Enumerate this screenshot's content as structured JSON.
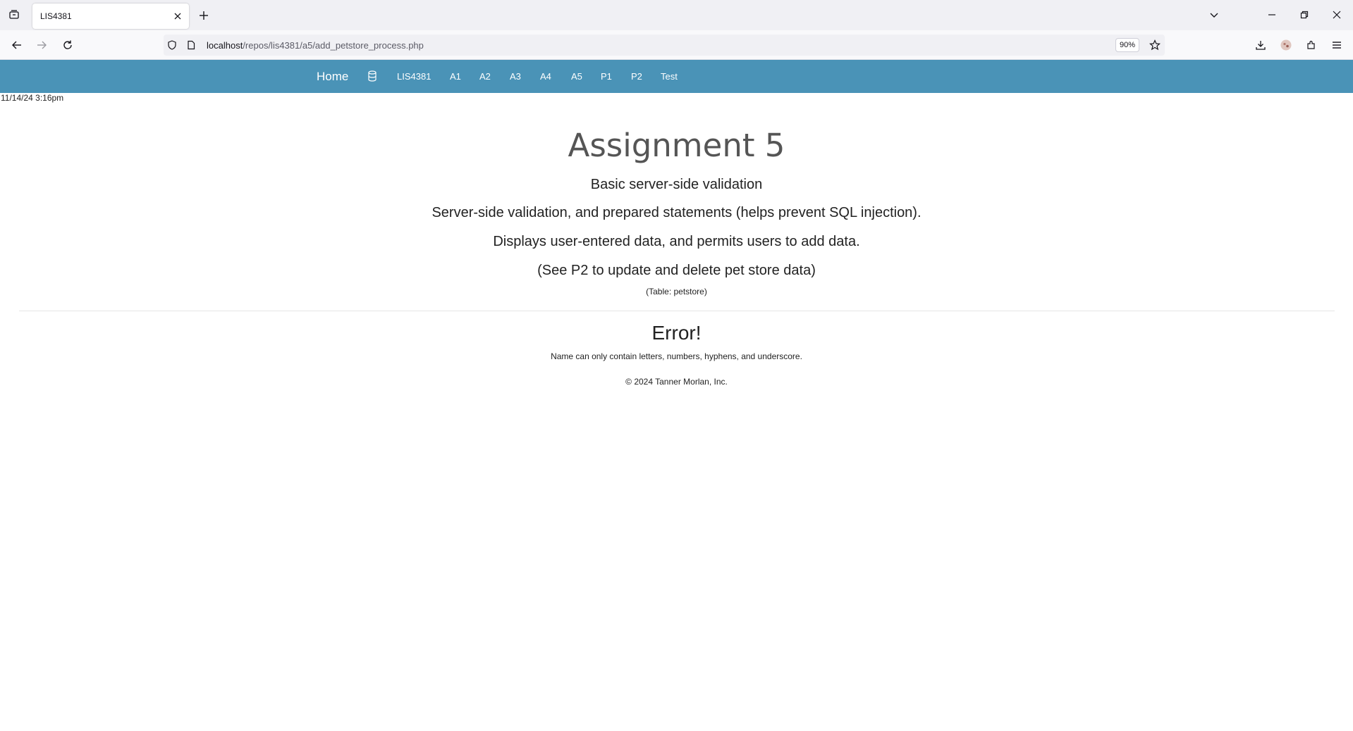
{
  "browser": {
    "tab_title": "LIS4381",
    "url_host": "localhost",
    "url_path": "/repos/lis4381/a5/add_petstore_process.php",
    "zoom": "90%",
    "icons": [
      "tab-list-icon",
      "close-icon",
      "plus-icon",
      "chevron-down-icon",
      "minimize-icon",
      "restore-icon",
      "close-window-icon",
      "back-arrow-icon",
      "forward-arrow-icon",
      "reload-icon",
      "shield-icon",
      "page-icon",
      "star-icon",
      "download-icon",
      "profile-icon",
      "extensions-icon",
      "menu-icon"
    ]
  },
  "site_nav": {
    "brand": "Home",
    "db_icon": "database-icon",
    "items": [
      "LIS4381",
      "A1",
      "A2",
      "A3",
      "A4",
      "A5",
      "P1",
      "P2",
      "Test"
    ],
    "background_color": "#4a93b7"
  },
  "page": {
    "timestamp": "11/14/24 3:16pm",
    "title": "Assignment 5",
    "subtitle": "Basic server-side validation",
    "lines": [
      "Server-side validation, and prepared statements (helps prevent SQL injection).",
      "Displays user-entered data, and permits users to add data.",
      "(See P2 to update and delete pet store data)"
    ],
    "table_note": "(Table: petstore)",
    "error_title": "Error!",
    "error_message": "Name can only contain letters, numbers, hyphens, and underscore.",
    "footer": "© 2024 Tanner Morlan, Inc."
  }
}
